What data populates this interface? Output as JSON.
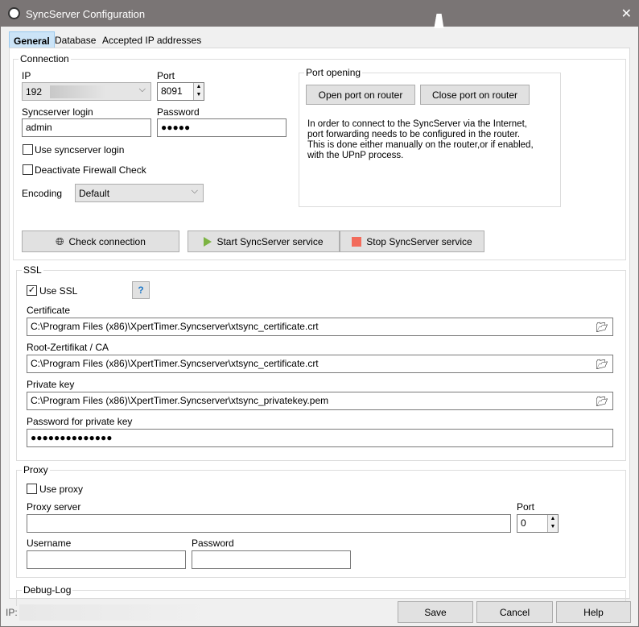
{
  "window": {
    "title": "SyncServer Configuration",
    "close": "✕"
  },
  "tabs": [
    {
      "label": "General"
    },
    {
      "label": "Database"
    },
    {
      "label": "Accepted IP addresses"
    }
  ],
  "connection": {
    "title": "Connection",
    "ip_label": "IP",
    "ip_value": "192",
    "port_label": "Port",
    "port_value": "8091",
    "login_label": "Syncserver login",
    "login_value": "admin",
    "password_label": "Password",
    "password_value": "●●●●●",
    "use_login": "Use syncserver login",
    "use_login_checked": false,
    "deactivate_firewall": "Deactivate Firewall Check",
    "deactivate_firewall_checked": false,
    "encoding_label": "Encoding",
    "encoding_value": "Default",
    "check_connection": "Check connection",
    "start_service": "Start SyncServer service",
    "stop_service": "Stop SyncServer service"
  },
  "port_opening": {
    "title": "Port opening",
    "open_button": "Open port on router",
    "close_button": "Close port on router",
    "info_lines": [
      "In order to connect to the SyncServer via the Internet,",
      "port forwarding  needs to be configured in the router.",
      "This is done either manually on the router,or if enabled,",
      "with the UPnP process."
    ]
  },
  "ssl": {
    "title": "SSL",
    "use_ssl": "Use SSL",
    "use_ssl_checked": true,
    "certificate_label": "Certificate",
    "certificate_value": "C:\\Program Files (x86)\\XpertTimer.Syncserver\\xtsync_certificate.crt",
    "root_label": "Root-Zertifikat / CA",
    "root_value": "C:\\Program Files (x86)\\XpertTimer.Syncserver\\xtsync_certificate.crt",
    "key_label": "Private key",
    "key_value": "C:\\Program Files (x86)\\XpertTimer.Syncserver\\xtsync_privatekey.pem",
    "key_password_label": "Password for private key",
    "key_password_value": "●●●●●●●●●●●●●●"
  },
  "proxy": {
    "title": "Proxy",
    "use_proxy": "Use proxy",
    "use_proxy_checked": false,
    "server_label": "Proxy server",
    "server_value": "",
    "port_label": "Port",
    "port_value": "0",
    "username_label": "Username",
    "username_value": "",
    "password_label": "Password",
    "password_value": ""
  },
  "debug": {
    "title": "Debug-Log"
  },
  "footer": {
    "ip_label": "IP:",
    "save": "Save",
    "cancel": "Cancel",
    "help": "Help"
  },
  "colors": {
    "titlebar": "#7a7575",
    "tab_active": "#cce4f7",
    "start_icon": "#7cb342",
    "stop_icon": "#f26b5b"
  }
}
